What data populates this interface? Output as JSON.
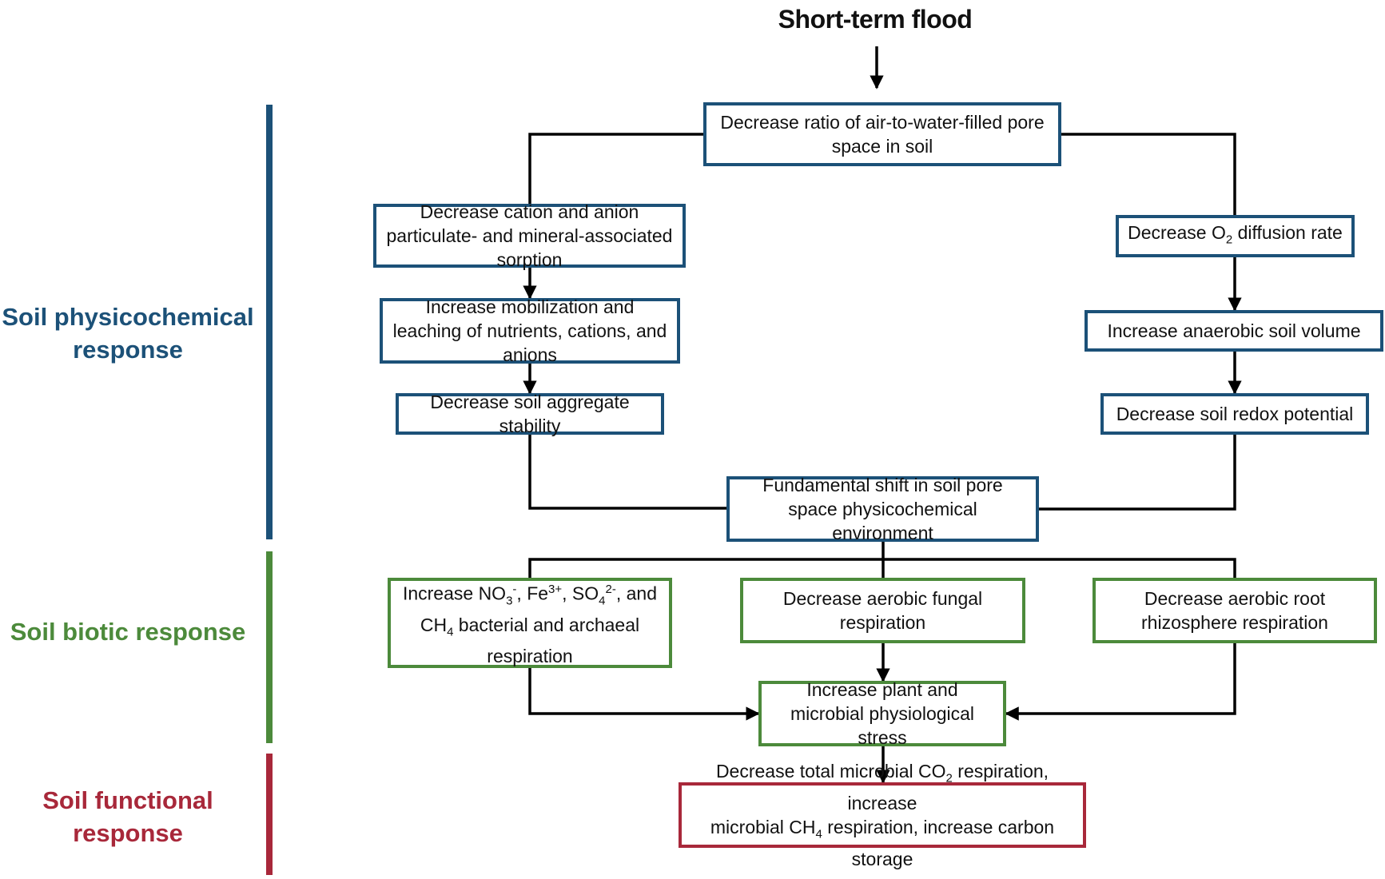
{
  "title": "Short-term flood",
  "colors": {
    "physicochemical": "#1c5178",
    "biotic": "#4c8a3b",
    "functional": "#a8283a",
    "connector": "#000000"
  },
  "sections": {
    "physicochemical": "Soil physicochemical response",
    "biotic": "Soil biotic response",
    "functional": "Soil functional response"
  },
  "nodes": {
    "pore_ratio": "Decrease ratio of air-to-water-filled pore space in soil",
    "sorption": "Decrease cation and anion particulate- and mineral-associated sorption",
    "mobilization": "Increase mobilization and leaching of nutrients, cations, and anions",
    "aggregate": "Decrease soil aggregate stability",
    "o2_a": "Decrease O",
    "o2_sub": "2",
    "o2_b": " diffusion rate",
    "anaerobic": "Increase anaerobic soil volume",
    "redox": "Decrease soil redox potential",
    "shift": "Fundamental shift in soil pore space physicochemical environment",
    "respiration_a": "Increase NO",
    "respiration_b": "3",
    "respiration_c": "-",
    "respiration_d": ", Fe",
    "respiration_e": "3+",
    "respiration_f": ", SO",
    "respiration_g": "4",
    "respiration_h": "2-",
    "respiration_i": ", and",
    "respiration_j": "CH",
    "respiration_k": "4",
    "respiration_l": " bacterial and archaeal",
    "respiration_m": "respiration",
    "fungal": "Decrease aerobic fungal respiration",
    "root": "Decrease aerobic root rhizosphere respiration",
    "stress": "Increase plant and microbial physiological stress",
    "final_a": "Decrease total microbial CO",
    "final_b": "2",
    "final_c": " respiration, increase",
    "final_d": "microbial CH",
    "final_e": "4",
    "final_f": " respiration, increase carbon storage"
  }
}
